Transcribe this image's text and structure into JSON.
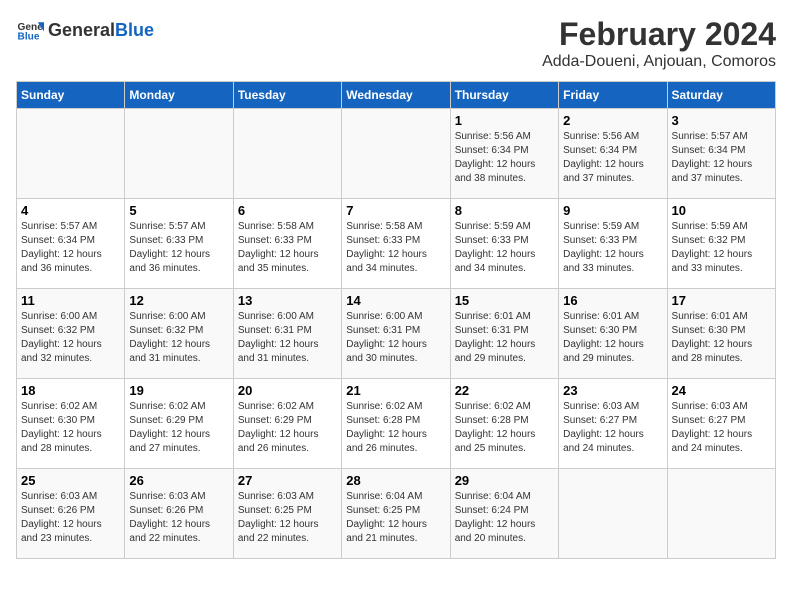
{
  "header": {
    "logo_general": "General",
    "logo_blue": "Blue",
    "title": "February 2024",
    "subtitle": "Adda-Doueni, Anjouan, Comoros"
  },
  "weekdays": [
    "Sunday",
    "Monday",
    "Tuesday",
    "Wednesday",
    "Thursday",
    "Friday",
    "Saturday"
  ],
  "weeks": [
    [
      {
        "day": "",
        "sunrise": "",
        "sunset": "",
        "daylight": ""
      },
      {
        "day": "",
        "sunrise": "",
        "sunset": "",
        "daylight": ""
      },
      {
        "day": "",
        "sunrise": "",
        "sunset": "",
        "daylight": ""
      },
      {
        "day": "",
        "sunrise": "",
        "sunset": "",
        "daylight": ""
      },
      {
        "day": "1",
        "sunrise": "Sunrise: 5:56 AM",
        "sunset": "Sunset: 6:34 PM",
        "daylight": "Daylight: 12 hours and 38 minutes."
      },
      {
        "day": "2",
        "sunrise": "Sunrise: 5:56 AM",
        "sunset": "Sunset: 6:34 PM",
        "daylight": "Daylight: 12 hours and 37 minutes."
      },
      {
        "day": "3",
        "sunrise": "Sunrise: 5:57 AM",
        "sunset": "Sunset: 6:34 PM",
        "daylight": "Daylight: 12 hours and 37 minutes."
      }
    ],
    [
      {
        "day": "4",
        "sunrise": "Sunrise: 5:57 AM",
        "sunset": "Sunset: 6:34 PM",
        "daylight": "Daylight: 12 hours and 36 minutes."
      },
      {
        "day": "5",
        "sunrise": "Sunrise: 5:57 AM",
        "sunset": "Sunset: 6:33 PM",
        "daylight": "Daylight: 12 hours and 36 minutes."
      },
      {
        "day": "6",
        "sunrise": "Sunrise: 5:58 AM",
        "sunset": "Sunset: 6:33 PM",
        "daylight": "Daylight: 12 hours and 35 minutes."
      },
      {
        "day": "7",
        "sunrise": "Sunrise: 5:58 AM",
        "sunset": "Sunset: 6:33 PM",
        "daylight": "Daylight: 12 hours and 34 minutes."
      },
      {
        "day": "8",
        "sunrise": "Sunrise: 5:59 AM",
        "sunset": "Sunset: 6:33 PM",
        "daylight": "Daylight: 12 hours and 34 minutes."
      },
      {
        "day": "9",
        "sunrise": "Sunrise: 5:59 AM",
        "sunset": "Sunset: 6:33 PM",
        "daylight": "Daylight: 12 hours and 33 minutes."
      },
      {
        "day": "10",
        "sunrise": "Sunrise: 5:59 AM",
        "sunset": "Sunset: 6:32 PM",
        "daylight": "Daylight: 12 hours and 33 minutes."
      }
    ],
    [
      {
        "day": "11",
        "sunrise": "Sunrise: 6:00 AM",
        "sunset": "Sunset: 6:32 PM",
        "daylight": "Daylight: 12 hours and 32 minutes."
      },
      {
        "day": "12",
        "sunrise": "Sunrise: 6:00 AM",
        "sunset": "Sunset: 6:32 PM",
        "daylight": "Daylight: 12 hours and 31 minutes."
      },
      {
        "day": "13",
        "sunrise": "Sunrise: 6:00 AM",
        "sunset": "Sunset: 6:31 PM",
        "daylight": "Daylight: 12 hours and 31 minutes."
      },
      {
        "day": "14",
        "sunrise": "Sunrise: 6:00 AM",
        "sunset": "Sunset: 6:31 PM",
        "daylight": "Daylight: 12 hours and 30 minutes."
      },
      {
        "day": "15",
        "sunrise": "Sunrise: 6:01 AM",
        "sunset": "Sunset: 6:31 PM",
        "daylight": "Daylight: 12 hours and 29 minutes."
      },
      {
        "day": "16",
        "sunrise": "Sunrise: 6:01 AM",
        "sunset": "Sunset: 6:30 PM",
        "daylight": "Daylight: 12 hours and 29 minutes."
      },
      {
        "day": "17",
        "sunrise": "Sunrise: 6:01 AM",
        "sunset": "Sunset: 6:30 PM",
        "daylight": "Daylight: 12 hours and 28 minutes."
      }
    ],
    [
      {
        "day": "18",
        "sunrise": "Sunrise: 6:02 AM",
        "sunset": "Sunset: 6:30 PM",
        "daylight": "Daylight: 12 hours and 28 minutes."
      },
      {
        "day": "19",
        "sunrise": "Sunrise: 6:02 AM",
        "sunset": "Sunset: 6:29 PM",
        "daylight": "Daylight: 12 hours and 27 minutes."
      },
      {
        "day": "20",
        "sunrise": "Sunrise: 6:02 AM",
        "sunset": "Sunset: 6:29 PM",
        "daylight": "Daylight: 12 hours and 26 minutes."
      },
      {
        "day": "21",
        "sunrise": "Sunrise: 6:02 AM",
        "sunset": "Sunset: 6:28 PM",
        "daylight": "Daylight: 12 hours and 26 minutes."
      },
      {
        "day": "22",
        "sunrise": "Sunrise: 6:02 AM",
        "sunset": "Sunset: 6:28 PM",
        "daylight": "Daylight: 12 hours and 25 minutes."
      },
      {
        "day": "23",
        "sunrise": "Sunrise: 6:03 AM",
        "sunset": "Sunset: 6:27 PM",
        "daylight": "Daylight: 12 hours and 24 minutes."
      },
      {
        "day": "24",
        "sunrise": "Sunrise: 6:03 AM",
        "sunset": "Sunset: 6:27 PM",
        "daylight": "Daylight: 12 hours and 24 minutes."
      }
    ],
    [
      {
        "day": "25",
        "sunrise": "Sunrise: 6:03 AM",
        "sunset": "Sunset: 6:26 PM",
        "daylight": "Daylight: 12 hours and 23 minutes."
      },
      {
        "day": "26",
        "sunrise": "Sunrise: 6:03 AM",
        "sunset": "Sunset: 6:26 PM",
        "daylight": "Daylight: 12 hours and 22 minutes."
      },
      {
        "day": "27",
        "sunrise": "Sunrise: 6:03 AM",
        "sunset": "Sunset: 6:25 PM",
        "daylight": "Daylight: 12 hours and 22 minutes."
      },
      {
        "day": "28",
        "sunrise": "Sunrise: 6:04 AM",
        "sunset": "Sunset: 6:25 PM",
        "daylight": "Daylight: 12 hours and 21 minutes."
      },
      {
        "day": "29",
        "sunrise": "Sunrise: 6:04 AM",
        "sunset": "Sunset: 6:24 PM",
        "daylight": "Daylight: 12 hours and 20 minutes."
      },
      {
        "day": "",
        "sunrise": "",
        "sunset": "",
        "daylight": ""
      },
      {
        "day": "",
        "sunrise": "",
        "sunset": "",
        "daylight": ""
      }
    ]
  ]
}
